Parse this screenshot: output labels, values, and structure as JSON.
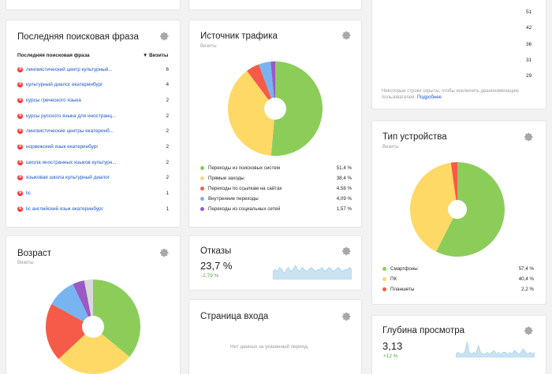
{
  "phrase_card": {
    "title": "Последняя поисковая фраза",
    "col_phrase": "Последняя поисковая фраза",
    "col_visits": "▼ Визиты",
    "rows": [
      {
        "phrase": "лингвистический центр культурный...",
        "visits": "6"
      },
      {
        "phrase": "культурный диалог екатеринбург",
        "visits": "4"
      },
      {
        "phrase": "курсы греческого языка",
        "visits": "2"
      },
      {
        "phrase": "курсы русского языка для иностранц...",
        "visits": "2"
      },
      {
        "phrase": "лингвистические центры екатеринб...",
        "visits": "2"
      },
      {
        "phrase": "норвежский язык екатеринбург",
        "visits": "2"
      },
      {
        "phrase": "школа иностранных языков культурн...",
        "visits": "2"
      },
      {
        "phrase": "языковая школа культурный диалог",
        "visits": "2"
      },
      {
        "phrase": "lic",
        "visits": "1"
      },
      {
        "phrase": "lic английский язык екатеринбург",
        "visits": "1"
      }
    ]
  },
  "traffic_card": {
    "title": "Источник трафика",
    "subtitle": "Визиты",
    "legend": [
      {
        "label": "Переходы из поисковых систем",
        "value": "51,4 %",
        "color": "#8ccd5a"
      },
      {
        "label": "Прямые заходы",
        "value": "38,4 %",
        "color": "#ffd966"
      },
      {
        "label": "Переходы по ссылкам на сайтах",
        "value": "4,56 %",
        "color": "#f55b48"
      },
      {
        "label": "Внутренние переходы",
        "value": "4,09 %",
        "color": "#78b5f0"
      },
      {
        "label": "Переходы из социальных сетей",
        "value": "1,57 %",
        "color": "#9b59c4"
      }
    ]
  },
  "age_card": {
    "title": "Возраст",
    "subtitle": "Визиты"
  },
  "bounce_card": {
    "title": "Отказы",
    "value": "23,7 %",
    "delta": "-2,79 %"
  },
  "entry_card": {
    "title": "Страница входа",
    "empty": "Нет данных за указанный период."
  },
  "top_right_card": {
    "numbers": [
      "51",
      "42",
      "36",
      "31",
      "29"
    ],
    "note": "Некоторые строки скрыты, чтобы исключить деанонимизацию пользователей.",
    "note_link": "Подробнее"
  },
  "device_card": {
    "title": "Тип устройства",
    "subtitle": "Визиты",
    "legend": [
      {
        "label": "Смартфоны",
        "value": "57,4 %",
        "color": "#8ccd5a"
      },
      {
        "label": "ПК",
        "value": "40,4 %",
        "color": "#ffd966"
      },
      {
        "label": "Планшеты",
        "value": "2,2 %",
        "color": "#f55b48"
      }
    ]
  },
  "depth_card": {
    "title": "Глубина просмотра",
    "value": "3,13",
    "delta": "+12 %"
  },
  "chart_data": [
    {
      "type": "pie",
      "title": "Источник трафика",
      "categories": [
        "Переходы из поисковых систем",
        "Прямые заходы",
        "Переходы по ссылкам на сайтах",
        "Внутренние переходы",
        "Переходы из социальных сетей"
      ],
      "values": [
        51.4,
        38.4,
        4.56,
        4.09,
        1.57
      ],
      "colors": [
        "#8ccd5a",
        "#ffd966",
        "#f55b48",
        "#78b5f0",
        "#9b59c4"
      ]
    },
    {
      "type": "pie",
      "title": "Тип устройства",
      "categories": [
        "Смартфоны",
        "ПК",
        "Планшеты"
      ],
      "values": [
        57.4,
        40.4,
        2.2
      ],
      "colors": [
        "#8ccd5a",
        "#ffd966",
        "#f55b48"
      ]
    },
    {
      "type": "pie",
      "title": "Возраст",
      "categories": [],
      "values": [
        36,
        27,
        20,
        10,
        4,
        3
      ],
      "colors": [
        "#8ccd5a",
        "#ffd966",
        "#f55b48",
        "#78b5f0",
        "#9b59c4",
        "#d9d9d9"
      ]
    },
    {
      "type": "area",
      "title": "Отказы",
      "values": [
        4,
        5,
        4,
        6,
        5,
        3,
        5,
        6,
        4,
        5,
        7,
        5,
        4,
        6,
        5,
        4,
        5,
        6,
        5,
        4,
        5,
        5,
        6,
        4,
        5,
        6,
        5,
        4,
        5,
        6,
        5,
        4,
        5,
        5,
        6,
        5
      ],
      "color": "#c9e3f3"
    },
    {
      "type": "area",
      "title": "Глубина просмотра",
      "values": [
        2,
        3,
        2,
        2,
        3,
        9,
        3,
        2,
        3,
        2,
        7,
        3,
        2,
        2,
        3,
        2,
        3,
        4,
        2,
        3,
        2,
        3,
        3,
        2,
        3,
        2,
        4,
        3,
        2,
        3,
        5,
        3,
        2,
        3,
        2,
        3
      ],
      "color": "#c9e3f3"
    }
  ]
}
